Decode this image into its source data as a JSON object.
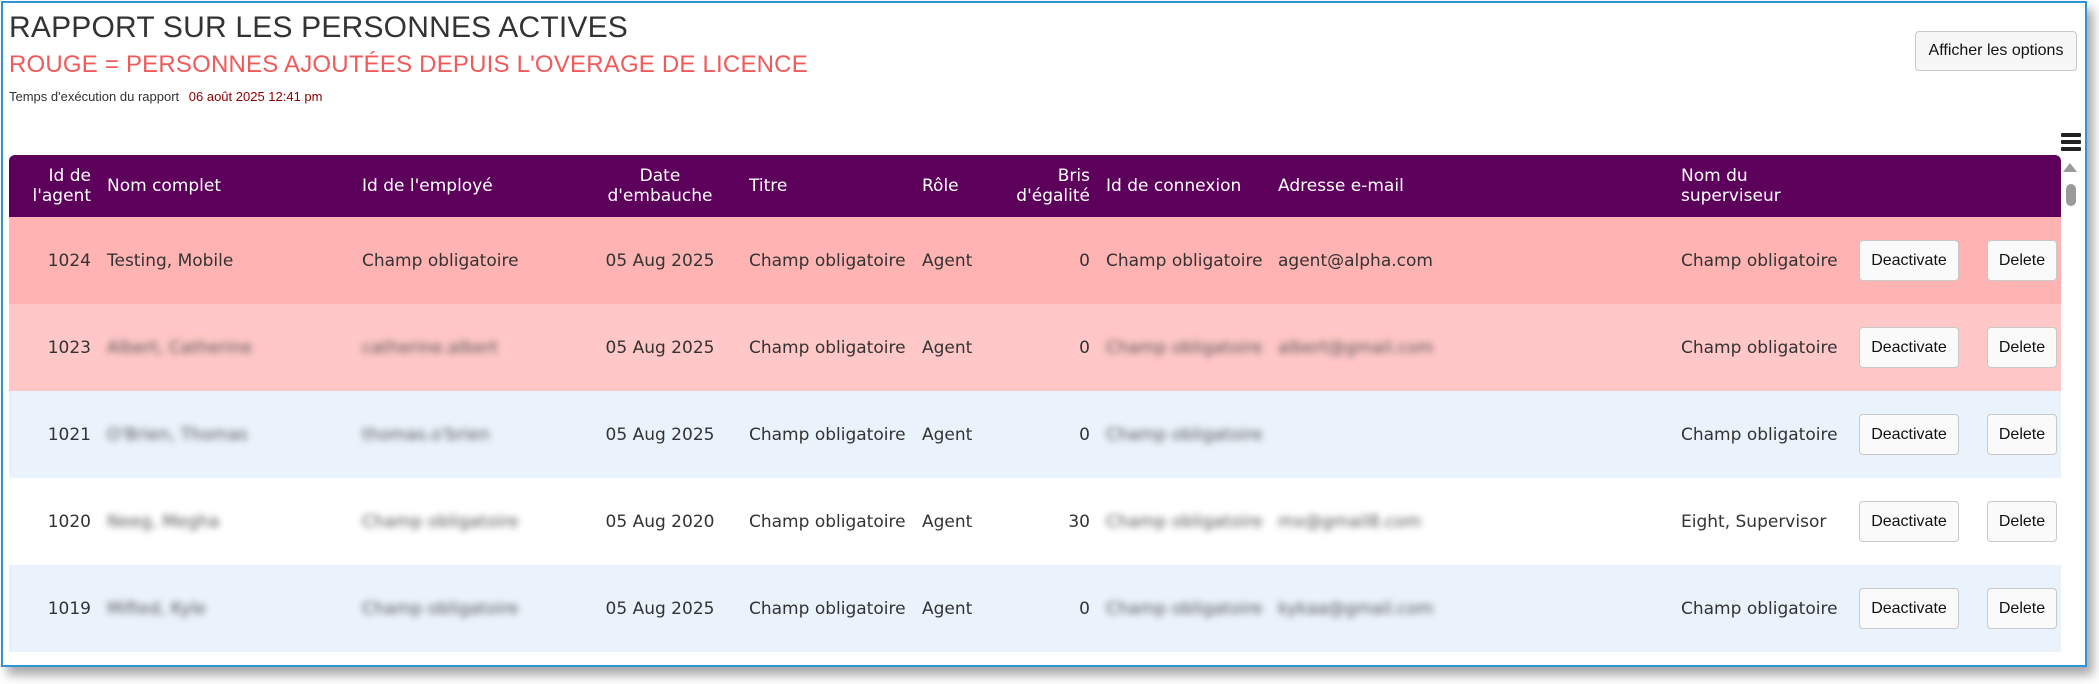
{
  "header": {
    "title": "RAPPORT SUR LES PERSONNES ACTIVES",
    "subtitle": "ROUGE = PERSONNES AJOUTÉES DEPUIS L'OVERAGE DE LICENCE",
    "runtime_label": "Temps d'exécution du rapport",
    "runtime_value": "06 août 2025 12:41 pm",
    "options_button": "Afficher les options"
  },
  "colors": {
    "header_bg": "#5c005c",
    "row_new_dark": "#ffb3b3",
    "row_new_light": "#ffc7c7",
    "row_alt": "#eaf3fb",
    "subtitle": "#f05a5a",
    "accent_border": "#2e94d3"
  },
  "icons": {
    "menu": "hamburger-menu-icon",
    "scroll_up": "scroll-up-arrow-icon"
  },
  "table": {
    "columns": {
      "agent_id": "Id de l'agent",
      "full_name": "Nom complet",
      "employee_id": "Id de l'employé",
      "hire_date": "Date d'embauche",
      "title": "Titre",
      "role": "Rôle",
      "tiebreak": "Bris d'égalité",
      "login_id": "Id de connexion",
      "email": "Adresse e-mail",
      "supervisor": "Nom du superviseur"
    },
    "rows": [
      {
        "agent_id": "1024",
        "full_name": "Testing, Mobile",
        "employee_id": "Champ obligatoire",
        "hire_date": "05 Aug 2025",
        "title": "Champ obligatoire",
        "role": "Agent",
        "tiebreak": "0",
        "login_id": "Champ obligatoire",
        "email": "agent@alpha.com",
        "supervisor": "Champ obligatoire",
        "deactivate": "Deactivate",
        "delete": "Delete"
      },
      {
        "agent_id": "1023",
        "full_name": "Albert, Catherine",
        "employee_id": "catherine.albert",
        "hire_date": "05 Aug 2025",
        "title": "Champ obligatoire",
        "role": "Agent",
        "tiebreak": "0",
        "login_id": "Champ obligatoire",
        "email": "albert@gmail.com",
        "supervisor": "Champ obligatoire",
        "deactivate": "Deactivate",
        "delete": "Delete"
      },
      {
        "agent_id": "1021",
        "full_name": "O'Brien, Thomas",
        "employee_id": "thomas.o'brien",
        "hire_date": "05 Aug 2025",
        "title": "Champ obligatoire",
        "role": "Agent",
        "tiebreak": "0",
        "login_id": "Champ obligatoire",
        "email": "",
        "supervisor": "Champ obligatoire",
        "deactivate": "Deactivate",
        "delete": "Delete"
      },
      {
        "agent_id": "1020",
        "full_name": "Neeg, Megha",
        "employee_id": "Champ obligatoire",
        "hire_date": "05 Aug 2020",
        "title": "Champ obligatoire",
        "role": "Agent",
        "tiebreak": "30",
        "login_id": "Champ obligatoire",
        "email": "mx@gmail8.com",
        "supervisor": "Eight, Supervisor",
        "deactivate": "Deactivate",
        "delete": "Delete"
      },
      {
        "agent_id": "1019",
        "full_name": "Mifted, Kyle",
        "employee_id": "Champ obligatoire",
        "hire_date": "05 Aug 2025",
        "title": "Champ obligatoire",
        "role": "Agent",
        "tiebreak": "0",
        "login_id": "Champ obligatoire",
        "email": "kykaa@gmail.com",
        "supervisor": "Champ obligatoire",
        "deactivate": "Deactivate",
        "delete": "Delete"
      }
    ]
  }
}
